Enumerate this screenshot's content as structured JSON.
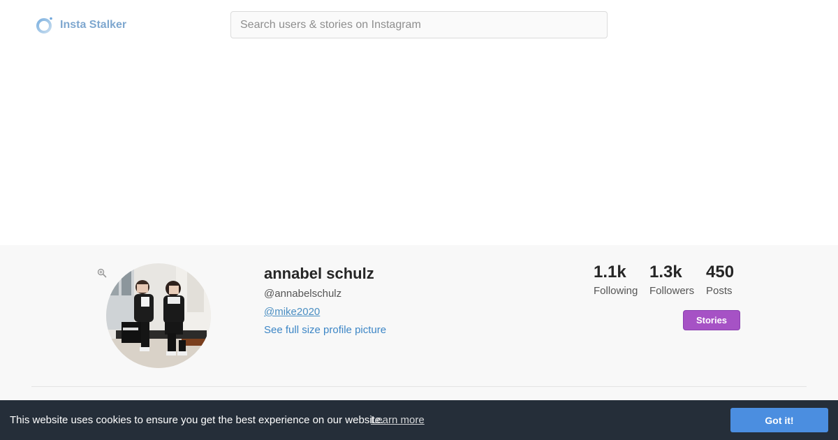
{
  "header": {
    "logo_text": "Insta Stalker",
    "logo_icon": "ring-logo-icon",
    "search_placeholder": "Search users & stories on Instagram",
    "search_value": ""
  },
  "profile": {
    "name": "annabel schulz",
    "handle": "@annabelschulz",
    "mention": "@mike2020",
    "full_size_link": "See full size profile picture",
    "zoom_icon": "zoom-in-icon",
    "avatar_icon": "profile-photo"
  },
  "stats": {
    "following": {
      "value": "1.1k",
      "label": "Following"
    },
    "followers": {
      "value": "1.3k",
      "label": "Followers"
    },
    "posts": {
      "value": "450",
      "label": "Posts"
    }
  },
  "actions": {
    "stories_label": "Stories"
  },
  "cookie_banner": {
    "message": "This website uses cookies to ensure you get the best experience on our website.",
    "learn_more": "Learn more",
    "accept_label": "Got it!"
  },
  "colors": {
    "brand_text": "#7ea7cf",
    "link": "#3d86c6",
    "stories_button": "#a652c5",
    "cookie_bg": "#252e39",
    "cookie_button": "#4b8ee0",
    "section_bg": "#f8f8f8"
  }
}
